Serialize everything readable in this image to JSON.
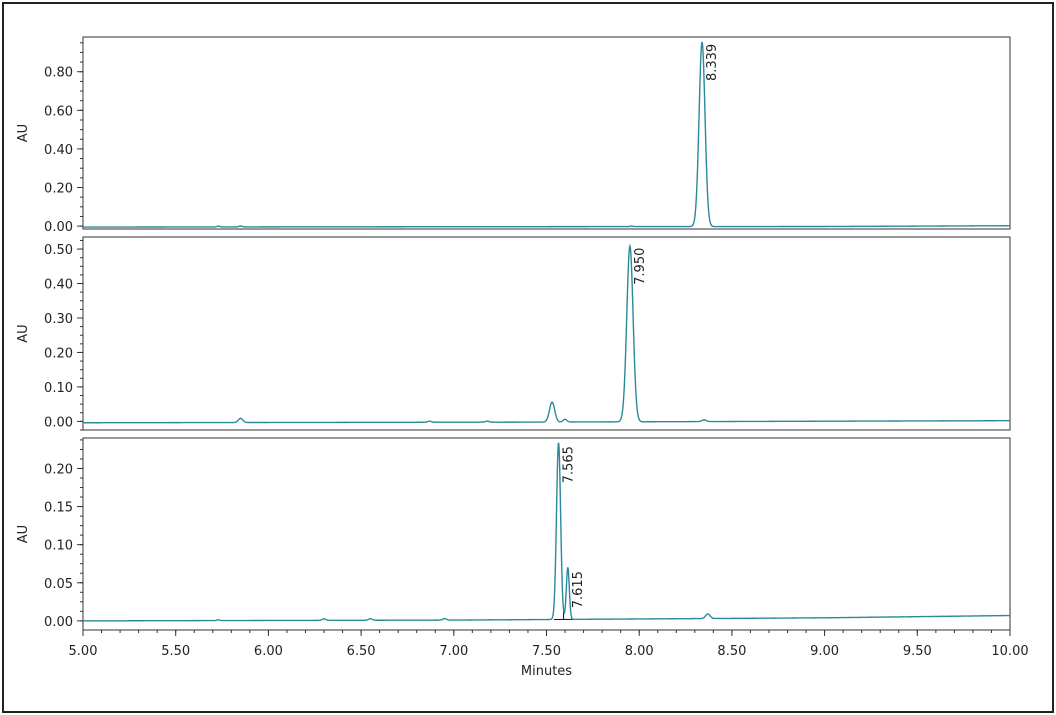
{
  "chart_data": [
    {
      "type": "line",
      "ylabel": "AU",
      "xlim": [
        5.0,
        10.0
      ],
      "ylim": [
        -0.015,
        0.98
      ],
      "yticks": [
        "0.00",
        "0.20",
        "0.40",
        "0.60",
        "0.80"
      ],
      "ytick_values": [
        0.0,
        0.2,
        0.4,
        0.6,
        0.8
      ],
      "color": "#2a8a9a",
      "baseline": [
        [
          5.0,
          -0.005
        ],
        [
          7.0,
          -0.003
        ],
        [
          9.0,
          -0.002
        ],
        [
          9.5,
          0.0
        ],
        [
          10.0,
          0.002
        ]
      ],
      "peaks": [
        {
          "rt": 5.73,
          "height": 0.004,
          "sigma": 0.008
        },
        {
          "rt": 5.85,
          "height": 0.005,
          "sigma": 0.008
        },
        {
          "rt": 7.96,
          "height": 0.003,
          "sigma": 0.008
        },
        {
          "rt": 8.339,
          "height": 0.955,
          "sigma": 0.016
        }
      ],
      "labels": [
        {
          "text": "8.339",
          "x": 8.339,
          "y": 0.955
        }
      ]
    },
    {
      "type": "line",
      "ylabel": "AU",
      "xlim": [
        5.0,
        10.0
      ],
      "ylim": [
        -0.025,
        0.535
      ],
      "yticks": [
        "0.00",
        "0.10",
        "0.20",
        "0.30",
        "0.40",
        "0.50"
      ],
      "ytick_values": [
        0.0,
        0.1,
        0.2,
        0.3,
        0.4,
        0.5
      ],
      "color": "#2a8a9a",
      "baseline": [
        [
          5.0,
          -0.004
        ],
        [
          7.5,
          -0.002
        ],
        [
          9.3,
          0.001
        ],
        [
          10.0,
          0.002
        ]
      ],
      "peaks": [
        {
          "rt": 5.85,
          "height": 0.012,
          "sigma": 0.012
        },
        {
          "rt": 6.87,
          "height": 0.003,
          "sigma": 0.01
        },
        {
          "rt": 7.18,
          "height": 0.003,
          "sigma": 0.01
        },
        {
          "rt": 7.53,
          "height": 0.058,
          "sigma": 0.014
        },
        {
          "rt": 7.6,
          "height": 0.008,
          "sigma": 0.01
        },
        {
          "rt": 7.95,
          "height": 0.51,
          "sigma": 0.017
        },
        {
          "rt": 8.35,
          "height": 0.005,
          "sigma": 0.012
        }
      ],
      "labels": [
        {
          "text": "7.950",
          "x": 7.95,
          "y": 0.51
        }
      ]
    },
    {
      "type": "line",
      "ylabel": "AU",
      "xlabel": "Minutes",
      "xlim": [
        5.0,
        10.0
      ],
      "xticks": [
        "5.00",
        "5.50",
        "6.00",
        "6.50",
        "7.00",
        "7.50",
        "8.00",
        "8.50",
        "9.00",
        "9.50",
        "10.00"
      ],
      "xtick_values": [
        5.0,
        5.5,
        6.0,
        6.5,
        7.0,
        7.5,
        8.0,
        8.5,
        9.0,
        9.5,
        10.0
      ],
      "ylim": [
        -0.012,
        0.24
      ],
      "yticks": [
        "0.00",
        "0.05",
        "0.10",
        "0.15",
        "0.20"
      ],
      "ytick_values": [
        0.0,
        0.05,
        0.1,
        0.15,
        0.2
      ],
      "color": "#2a8a9a",
      "baseline": [
        [
          5.0,
          0.0
        ],
        [
          7.0,
          0.001
        ],
        [
          9.0,
          0.004
        ],
        [
          10.0,
          0.007
        ]
      ],
      "peaks": [
        {
          "rt": 5.73,
          "height": 0.001,
          "sigma": 0.008
        },
        {
          "rt": 6.3,
          "height": 0.002,
          "sigma": 0.01
        },
        {
          "rt": 6.55,
          "height": 0.002,
          "sigma": 0.01
        },
        {
          "rt": 6.95,
          "height": 0.002,
          "sigma": 0.01
        },
        {
          "rt": 7.565,
          "height": 0.232,
          "sigma": 0.011
        },
        {
          "rt": 7.615,
          "height": 0.068,
          "sigma": 0.008
        },
        {
          "rt": 8.37,
          "height": 0.006,
          "sigma": 0.012
        }
      ],
      "labels": [
        {
          "text": "7.565",
          "x": 7.565,
          "y": 0.232
        },
        {
          "text": "7.615",
          "x": 7.615,
          "y": 0.068
        }
      ],
      "baseline_drop": {
        "from": 7.54,
        "to": 7.64,
        "split_at": 7.592
      }
    }
  ]
}
